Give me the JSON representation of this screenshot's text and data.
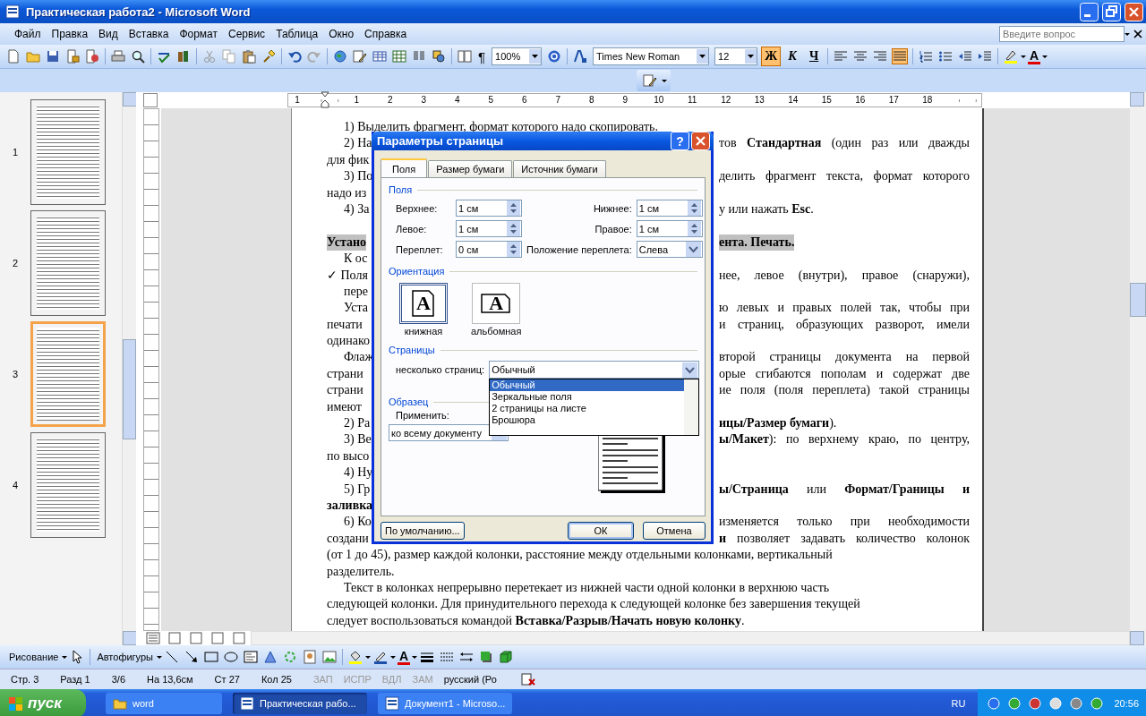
{
  "window": {
    "title": "Практическая  работа2 - Microsoft Word"
  },
  "menu": {
    "items": [
      "Файл",
      "Правка",
      "Вид",
      "Вставка",
      "Формат",
      "Сервис",
      "Таблица",
      "Окно",
      "Справка"
    ],
    "help_box": {
      "placeholder": "Введите вопрос"
    }
  },
  "standard_toolbar": {
    "pilcrow": "¶",
    "zoom": "100%"
  },
  "formatting_toolbar": {
    "font": "Times New Roman",
    "size": "12",
    "styles": [
      {
        "label": "Ж",
        "pressed": true
      },
      {
        "label": "К",
        "pressed": false
      },
      {
        "label": "Ч",
        "pressed": false
      }
    ],
    "alignment": [
      {
        "selected": false
      },
      {
        "selected": false
      },
      {
        "selected": false
      },
      {
        "selected": true
      }
    ],
    "font_color_label": "A"
  },
  "thumbnails": [
    {
      "page": "1",
      "selected": false
    },
    {
      "page": "2",
      "selected": false
    },
    {
      "page": "3",
      "selected": true
    },
    {
      "page": "4",
      "selected": false
    }
  ],
  "ruler": {
    "left_labels": [
      "1"
    ],
    "labels": [
      "1",
      "2",
      "3",
      "4",
      "5",
      "6",
      "7",
      "8",
      "9",
      "10",
      "11",
      "12",
      "13",
      "14",
      "15",
      "16",
      "17",
      "18"
    ]
  },
  "document": {
    "paragraphs": [
      {
        "kind": "body",
        "lines": [
          {
            "kind": "full",
            "text": "1) Выделить фрагмент, формат которого надо скопировать."
          }
        ]
      },
      {
        "kind": "body",
        "lines": [
          {
            "kind": "split",
            "left": "2) На",
            "right": "тов **Стандартная** (один раз или дважды"
          },
          {
            "kind": "split",
            "left": "для фик"
          }
        ]
      },
      {
        "kind": "body",
        "lines": [
          {
            "kind": "split",
            "left": "3) По",
            "right": "делить фрагмент текста, формат которого"
          },
          {
            "kind": "split",
            "left": "надо из"
          }
        ]
      },
      {
        "kind": "body",
        "lines": [
          {
            "kind": "split",
            "left": "4) За",
            "right": "у или нажать **Esc**."
          }
        ]
      },
      {
        "kind": "heading",
        "lines": [
          {
            "kind": "split",
            "left": "Устано",
            "right": "ента. Печать."
          }
        ]
      },
      {
        "kind": "body",
        "lines": [
          {
            "kind": "split",
            "left": "К ос"
          }
        ]
      },
      {
        "kind": "check_item",
        "lines": [
          {
            "kind": "split",
            "left": "✓ Поля",
            "right": "нее, левое (внутри), правое (снаружи),"
          },
          {
            "kind": "split",
            "left": "пере"
          }
        ]
      },
      {
        "kind": "body",
        "lines": [
          {
            "kind": "split",
            "left": "Уста",
            "right": "ю левых и правых полей так, чтобы при"
          },
          {
            "kind": "split",
            "left": "печати",
            "right": "и страниц, образующих разворот, имели"
          },
          {
            "kind": "split",
            "left": "одинако"
          }
        ]
      },
      {
        "kind": "body",
        "lines": [
          {
            "kind": "split",
            "left": "Флаж",
            "right": "второй страницы документа на первой"
          },
          {
            "kind": "split",
            "left": "страни",
            "right": "орые сгибаются пополам и содержат две"
          },
          {
            "kind": "split",
            "left": "страни",
            "right": "ие поля (поля переплета) такой страницы"
          },
          {
            "kind": "split",
            "left": "имеют"
          }
        ]
      },
      {
        "kind": "body",
        "lines": [
          {
            "kind": "split",
            "left": "2) Ра",
            "right": "**ицы/Размер бумаги**)."
          }
        ]
      },
      {
        "kind": "body",
        "lines": [
          {
            "kind": "split",
            "left": "3) Ве",
            "right": "**ы/Макет**): по верхнему краю, по центру,"
          },
          {
            "kind": "split",
            "left": "по высо"
          }
        ]
      },
      {
        "kind": "body",
        "lines": [
          {
            "kind": "split",
            "left": "4) Ну"
          }
        ]
      },
      {
        "kind": "body",
        "lines": [
          {
            "kind": "split",
            "left": "5) Гр",
            "right": "**ы/Страница** или **Формат/Границы и**"
          },
          {
            "kind": "split",
            "left": "**заливка**"
          }
        ]
      },
      {
        "kind": "body",
        "lines": [
          {
            "kind": "split",
            "left": "6) Ко",
            "right": "изменяется только при необходимости"
          },
          {
            "kind": "split",
            "left": "создани",
            "right": "**и** позволяет задавать количество колонок"
          },
          {
            "kind": "full",
            "text": "(от 1 до 45), размер каждой колонки, расстояние между отдельными колонками, вертикальный"
          },
          {
            "kind": "full",
            "text": "разделитель."
          }
        ]
      },
      {
        "kind": "body",
        "lines": [
          {
            "kind": "full",
            "text": "Текст в колонках непрерывно перетекает из нижней части одной колонки в верхнюю часть"
          },
          {
            "kind": "full",
            "text": "следующей колонки. Для принудительного перехода к следующей колонке без завершения текущей"
          },
          {
            "kind": "full",
            "text": "следует воспользоваться командой **Вставка/Разрыв/Начать новую колонку**."
          }
        ]
      }
    ]
  },
  "dialog": {
    "title": "Параметры страницы",
    "help": "?",
    "tabs": [
      {
        "label": "Поля",
        "selected": true
      },
      {
        "label": "Размер бумаги",
        "selected": false
      },
      {
        "label": "Источник бумаги",
        "selected": false
      }
    ],
    "margins": {
      "heading": "Поля",
      "fields": [
        {
          "label": "Верхнее:",
          "value": "1 см"
        },
        {
          "label": "Нижнее:",
          "value": "1 см"
        },
        {
          "label": "Левое:",
          "value": "1 см"
        },
        {
          "label": "Правое:",
          "value": "1 см"
        },
        {
          "label": "Переплет:",
          "value": "0 см"
        }
      ],
      "gutter_position": {
        "label": "Положение переплета:",
        "value": "Слева"
      }
    },
    "orientation": {
      "heading": "Ориентация",
      "options": [
        {
          "kind": "portrait",
          "glyph": "A",
          "label": "книжная",
          "selected": true
        },
        {
          "kind": "landscape",
          "glyph": "A",
          "label": "альбомная",
          "selected": false
        }
      ]
    },
    "pages": {
      "heading": "Страницы",
      "label": "несколько страниц:",
      "value": "Обычный",
      "expanded": true,
      "options": [
        {
          "label": "Обычный",
          "selected": true
        },
        {
          "label": "Зеркальные поля",
          "selected": false
        },
        {
          "label": "2 страницы на листе",
          "selected": false
        },
        {
          "label": "Брошюра",
          "selected": false
        }
      ]
    },
    "preview": {
      "heading": "Образец",
      "apply_label": "Применить:",
      "apply_value": "ко всему документу"
    },
    "buttons": [
      {
        "label": "По умолчанию...",
        "default": false
      },
      {
        "label": "ОК",
        "default": true
      },
      {
        "label": "Отмена",
        "default": false
      }
    ]
  },
  "drawing_toolbar": {
    "draw_menu": "Рисование",
    "autoshapes": "Автофигуры",
    "font_color_label": "A"
  },
  "status_bar": [
    {
      "text": "Стр. 3",
      "disabled": false
    },
    {
      "text": "Разд 1",
      "disabled": false
    },
    {
      "text": "3/6",
      "disabled": false
    },
    {
      "text": "На 13,6см",
      "disabled": false
    },
    {
      "text": "Ст 27",
      "disabled": false
    },
    {
      "text": "Кол 25",
      "disabled": false
    },
    {
      "text": "ЗАП",
      "disabled": true
    },
    {
      "text": "ИСПР",
      "disabled": true
    },
    {
      "text": "ВДЛ",
      "disabled": true
    },
    {
      "text": "ЗАМ",
      "disabled": true
    },
    {
      "text": "русский (Ро",
      "disabled": false
    }
  ],
  "taskbar": {
    "start": "пуск",
    "tasks": [
      {
        "kind": "folder",
        "label": "word",
        "selected": false
      },
      {
        "kind": "document",
        "label": "Практическая рабо...",
        "selected": true
      },
      {
        "kind": "document",
        "label": "Документ1 - Microso...",
        "selected": false
      }
    ],
    "language": "RU",
    "clock": "20:56"
  }
}
